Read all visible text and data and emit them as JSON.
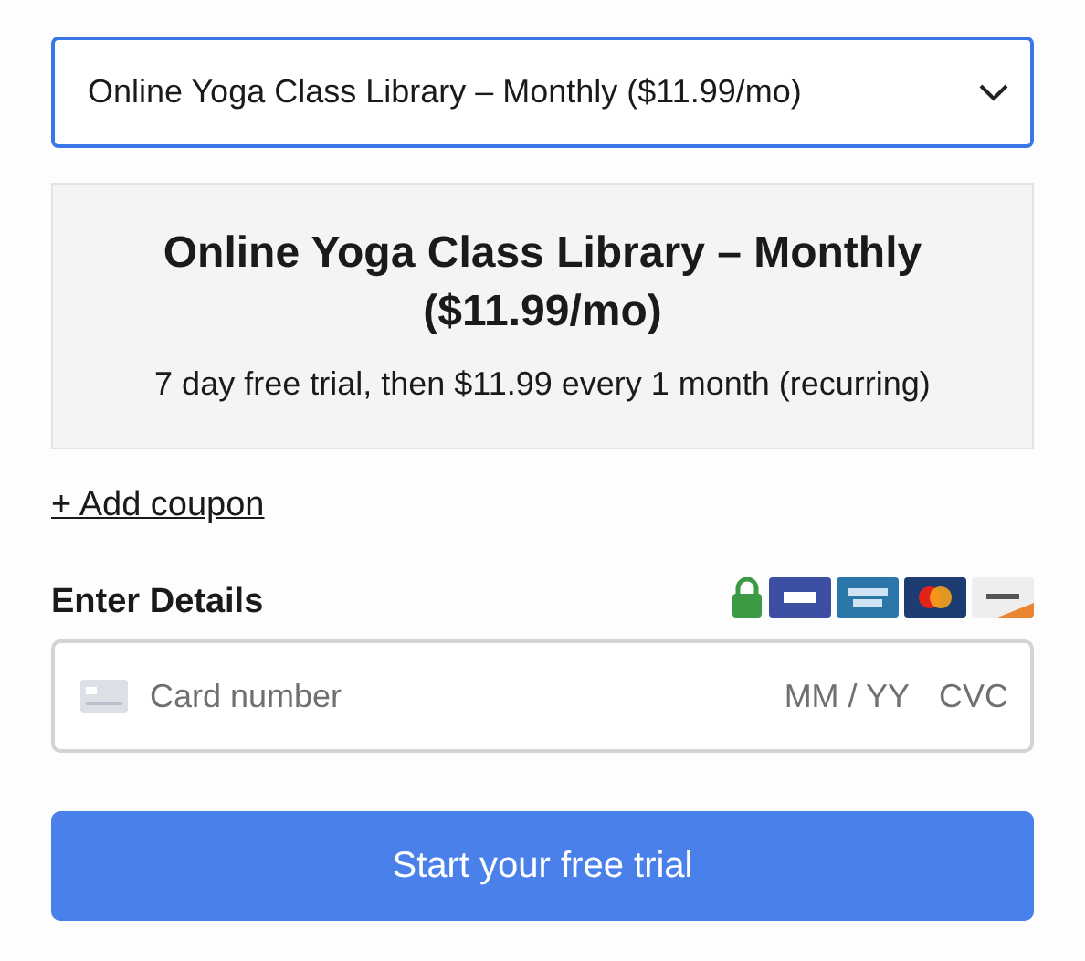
{
  "plan_select": {
    "value": "Online Yoga Class Library – Monthly ($11.99/mo)"
  },
  "summary": {
    "title": "Online Yoga Class Library – Monthly ($11.99/mo)",
    "description": "7 day free trial, then $11.99 every 1 month (recurring)"
  },
  "coupon_link": "+ Add coupon",
  "details": {
    "heading": "Enter Details"
  },
  "card_field": {
    "number_placeholder": "Card number",
    "expiry_placeholder": "MM / YY",
    "cvc_placeholder": "CVC"
  },
  "submit_button": "Start your free trial"
}
